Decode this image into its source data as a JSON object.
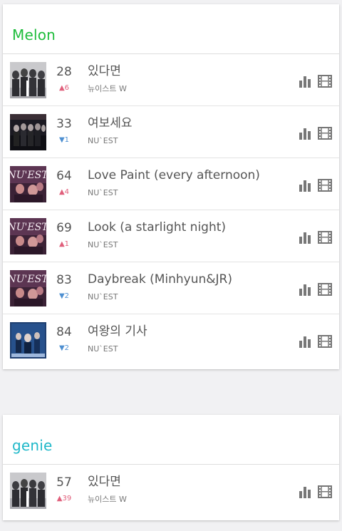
{
  "melon": {
    "name": "Melon",
    "color": "#1fbd3c",
    "rows": [
      {
        "rank": "28",
        "delta": "▲6",
        "direction": "up",
        "title": "있다면",
        "artist": "뉴이스트 W",
        "cover": "group-photo-bw"
      },
      {
        "rank": "33",
        "delta": "▼1",
        "direction": "down",
        "title": "여보세요",
        "artist": "NU`EST",
        "cover": "group-photo-dark"
      },
      {
        "rank": "64",
        "delta": "▲4",
        "direction": "up",
        "title": "Love Paint (every afternoon)",
        "artist": "NU`EST",
        "cover": "nuest-purple-cover"
      },
      {
        "rank": "69",
        "delta": "▲1",
        "direction": "up",
        "title": "Look (a starlight night)",
        "artist": "NU`EST",
        "cover": "nuest-purple-cover"
      },
      {
        "rank": "83",
        "delta": "▼2",
        "direction": "down",
        "title": "Daybreak (Minhyun&JR)",
        "artist": "NU`EST",
        "cover": "nuest-purple-cover"
      },
      {
        "rank": "84",
        "delta": "▼2",
        "direction": "down",
        "title": "여왕의 기사",
        "artist": "NU`EST",
        "cover": "blue-group-cover"
      }
    ]
  },
  "genie": {
    "name": "genie",
    "color": "#1fb8c9",
    "rows": [
      {
        "rank": "57",
        "delta": "▲39",
        "direction": "up",
        "title": "있다면",
        "artist": "뉴이스트 W",
        "cover": "group-photo-bw"
      }
    ]
  },
  "covers": {
    "cover_logo_text": "NU'EST"
  },
  "icons": {
    "chart": "bar-chart-icon",
    "video": "film-icon"
  }
}
